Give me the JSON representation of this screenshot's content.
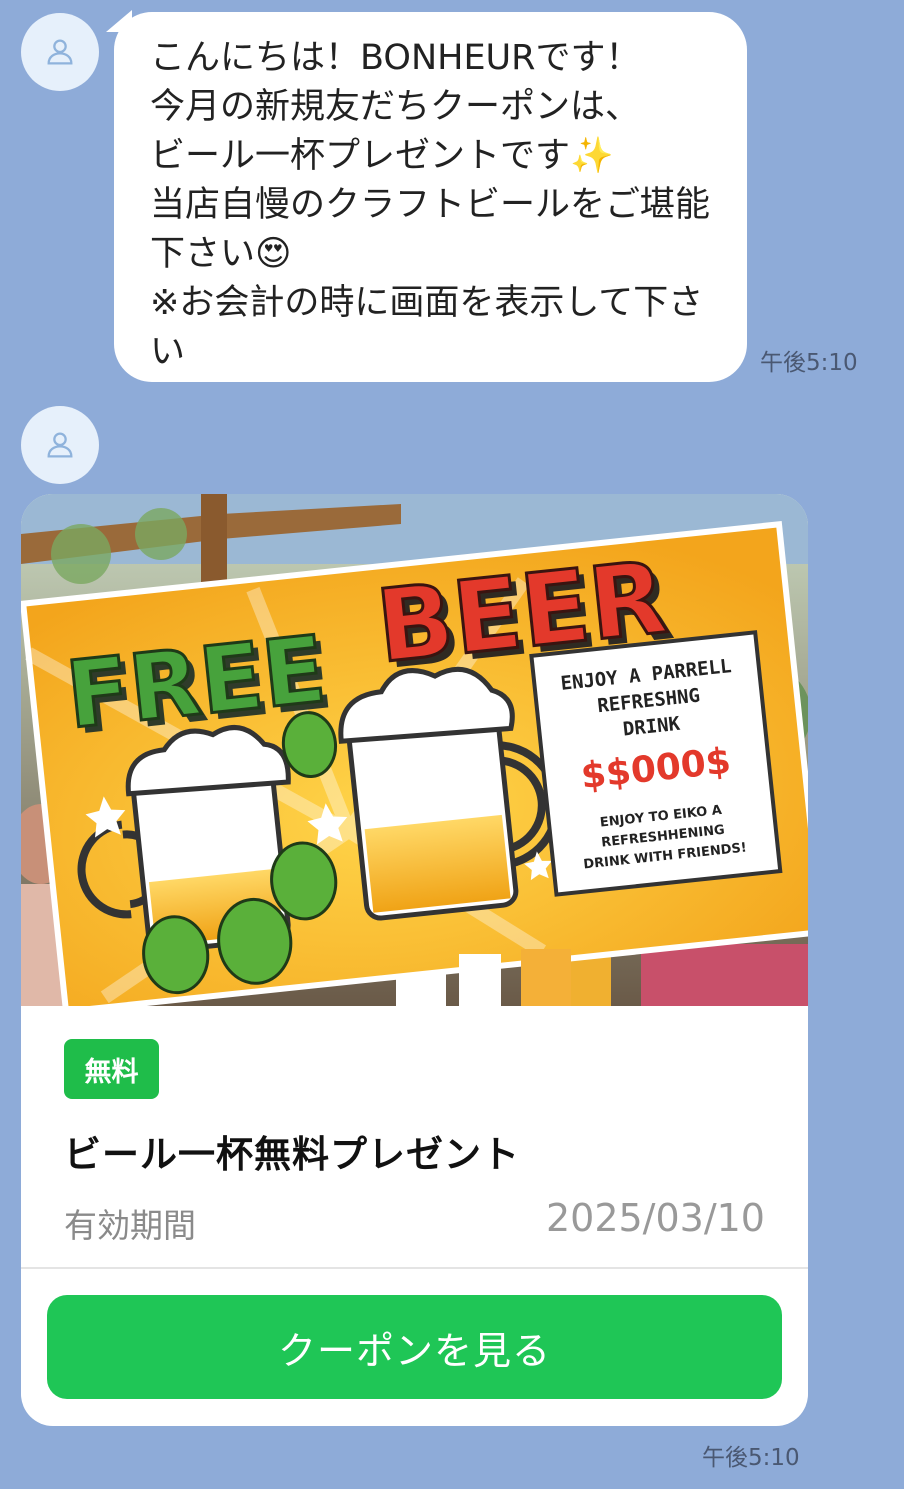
{
  "message1": {
    "text": "こんにちは！BONHEURです！\n今月の新規友だちクーポンは、\nビール一杯プレゼントです✨\n当店自慢のクラフトビールをご堪能下さい😍\n※お会計の時に画面を表示して下さい",
    "time": "午後5:10"
  },
  "coupon": {
    "image": {
      "headline_left": "FREE",
      "headline_right": "BEER",
      "sign_line1": "ENJOY A PARRELL",
      "sign_line2": "REFRESHNG",
      "sign_line3": "DRINK",
      "sign_price": "$$000$",
      "sign_line4": "ENJOY TO EIKO A",
      "sign_line5": "REFRESHHENING",
      "sign_line6": "DRINK WITH FRIENDS!"
    },
    "badge": "無料",
    "title": "ビール一杯無料プレゼント",
    "validity_label": "有効期間",
    "validity_date": "2025/03/10",
    "button_label": "クーポンを見る",
    "time": "午後5:10"
  },
  "icons": {
    "avatar": "user-avatar-icon"
  },
  "colors": {
    "background": "#8eabd8",
    "accent_green": "#1fc656",
    "badge_green": "#1fbd4a"
  }
}
